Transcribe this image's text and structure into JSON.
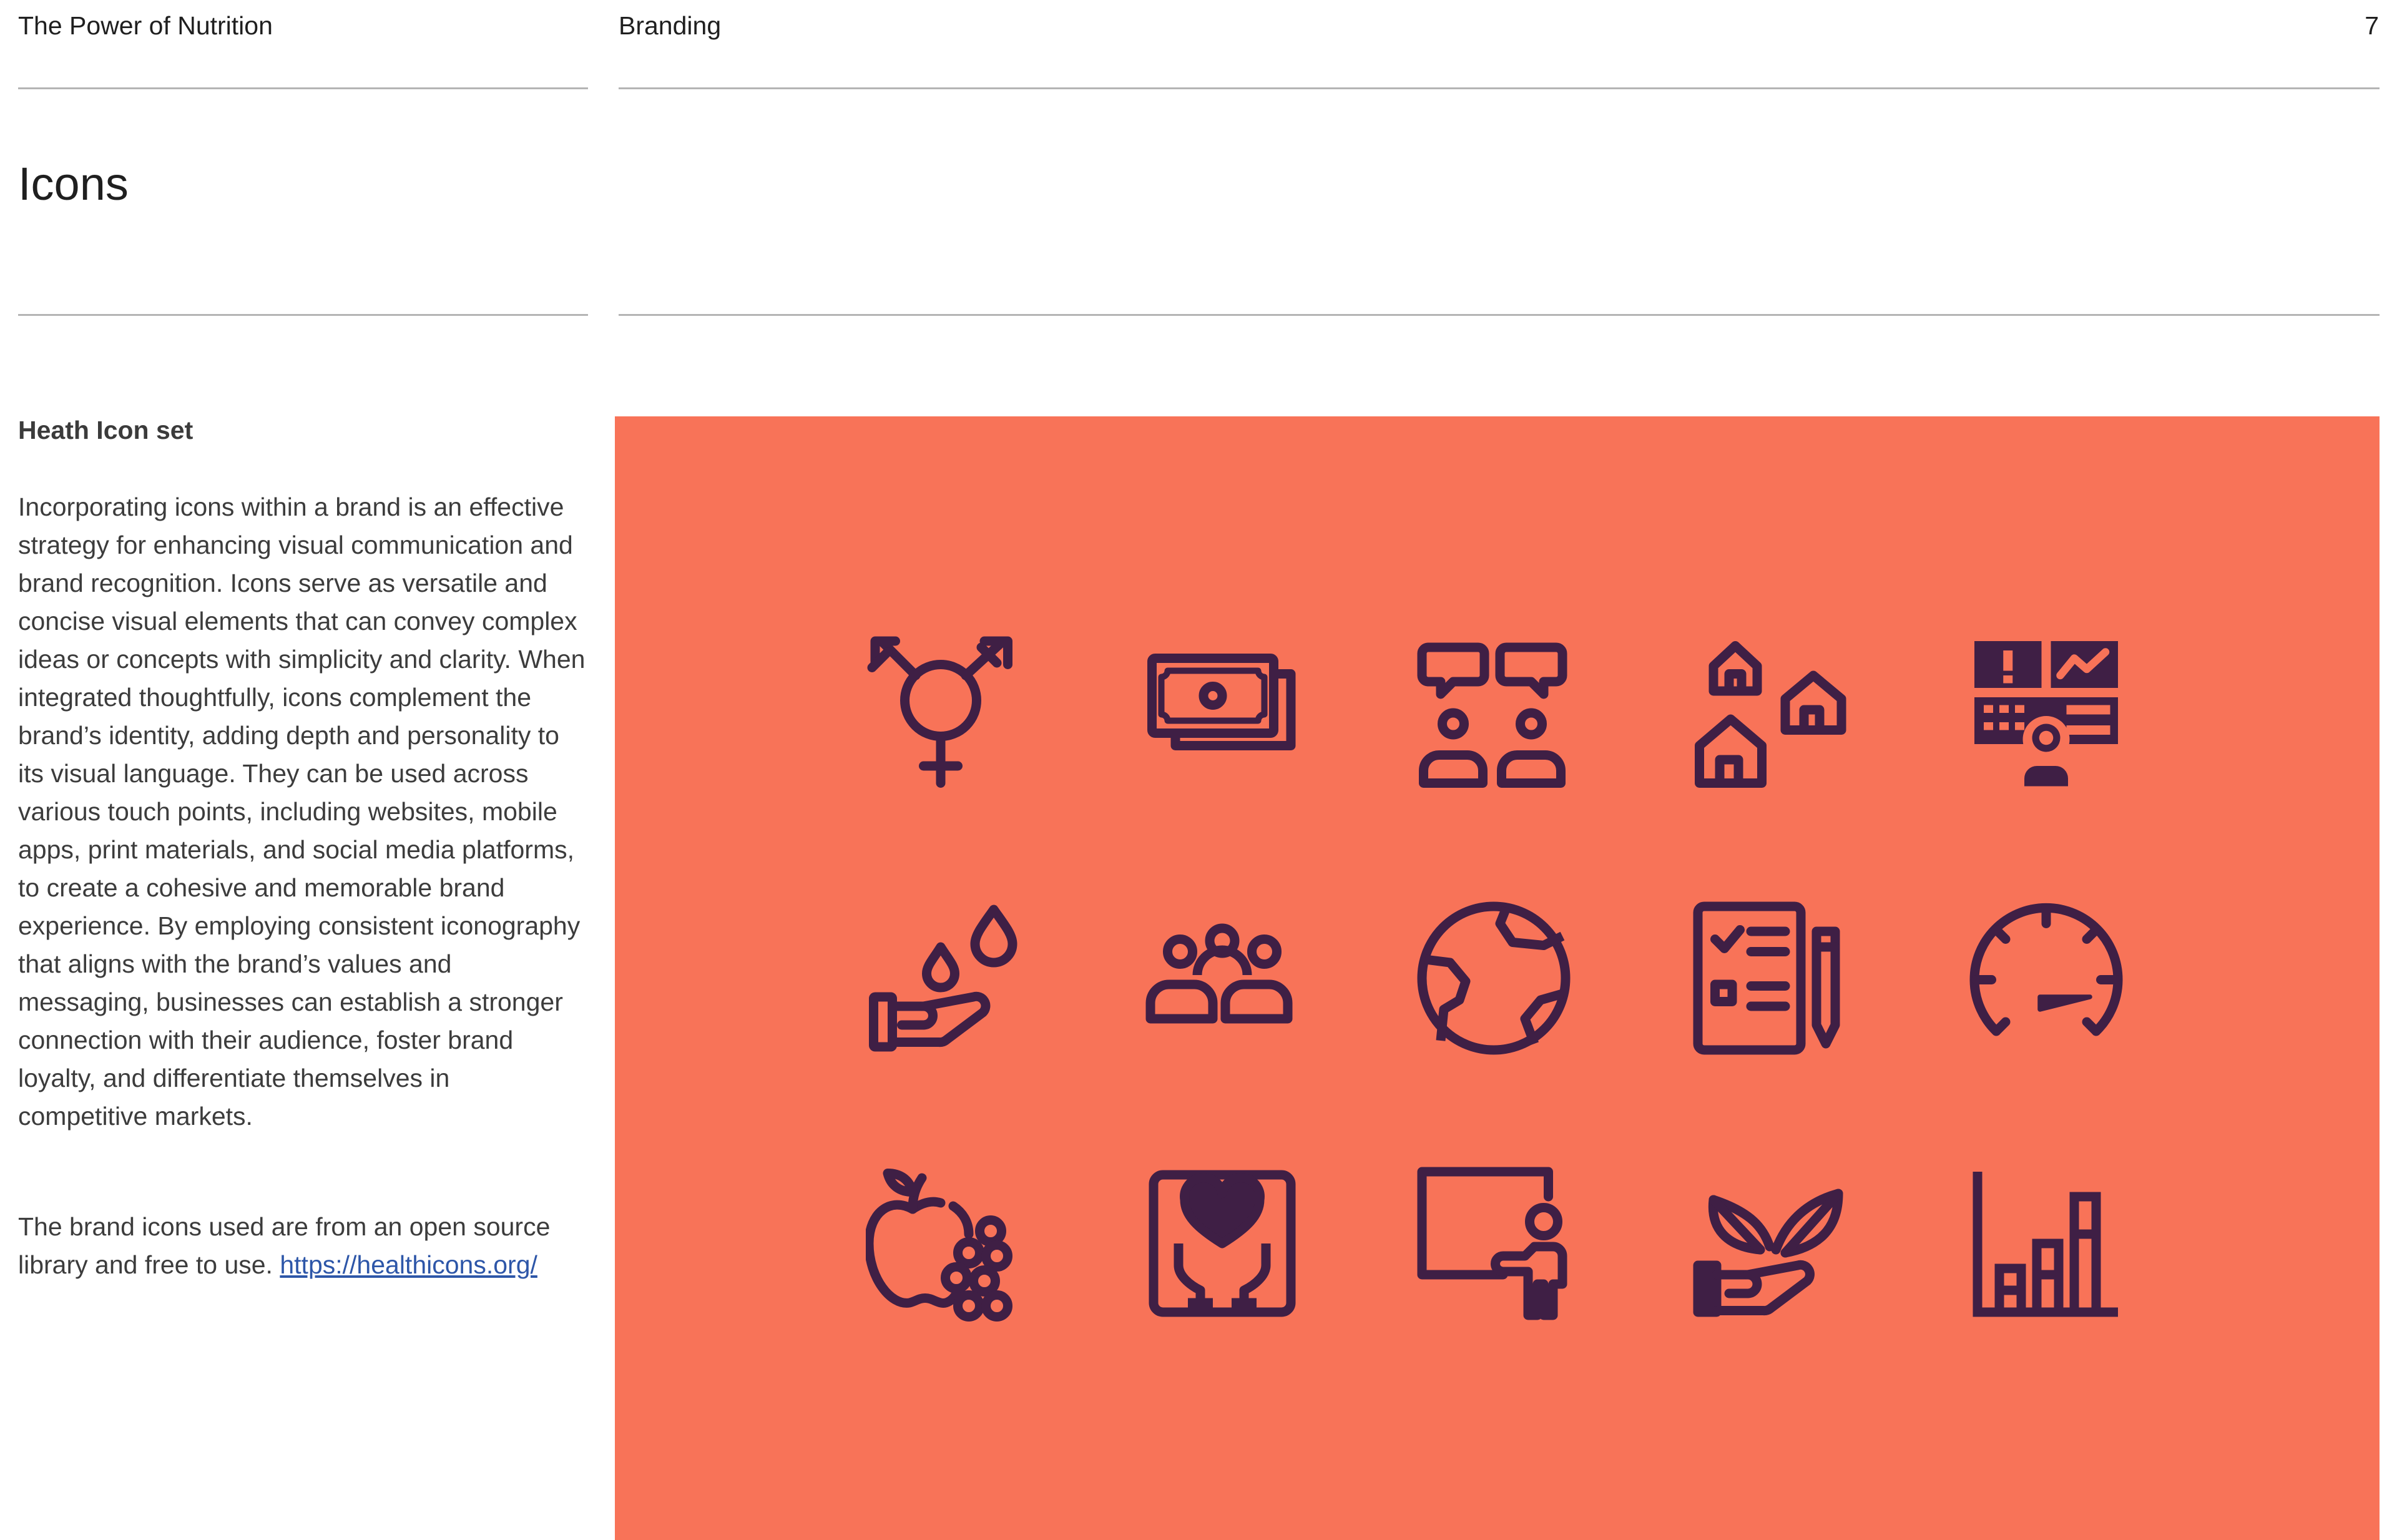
{
  "header": {
    "doc_title": "The Power of Nutrition",
    "section": "Branding",
    "page_number": "7"
  },
  "page_title": "Icons",
  "content": {
    "subheading": "Heath Icon set",
    "paragraph": "Incorporating icons within a brand is an effective strategy for enhancing visual communication and brand recognition. Icons serve as versatile and concise visual elements that can convey complex ideas or concepts with simplicity and clarity. When integrated thoughtfully, icons complement the brand’s identity, adding depth and personality to its visual language. They can be used across various touch points, including websites, mobile apps, print materials, and social media platforms, to create a cohesive and memorable brand experience. By employing consistent iconography that aligns with the brand’s values and messaging, businesses can establish a stronger connection with their audience, foster brand loyalty, and differentiate themselves in competitive markets.",
    "source_text": "The brand icons used are from an open source library and free to use.",
    "source_link": "https://healthicons.org/"
  },
  "icon_panel": {
    "background_color": "#f87358",
    "icon_color": "#3f1f45",
    "icons": [
      "transgender-icon",
      "money-icon",
      "conversation-icon",
      "houses-icon",
      "dashboard-icon",
      "water-hand-icon",
      "community-icon",
      "globe-icon",
      "checklist-icon",
      "speedometer-icon",
      "fruits-icon",
      "heart-care-icon",
      "presenter-icon",
      "plant-hand-icon",
      "bar-chart-icon"
    ]
  }
}
